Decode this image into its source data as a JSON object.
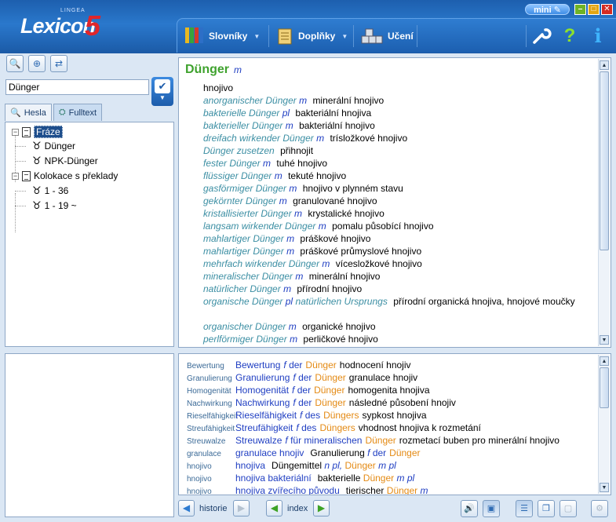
{
  "app": {
    "logo_small": "LINGEA",
    "logo_main": "Lexicon",
    "logo_number": "5",
    "mini_label": "mini"
  },
  "toolbar": {
    "slovniky": "Slovníky",
    "doplnky": "Doplňky",
    "uceni": "Učení",
    "help_symbol": "?",
    "info_symbol": "i"
  },
  "search": {
    "value": "Dünger"
  },
  "tabs": [
    {
      "label": "Hesla"
    },
    {
      "label": "Fulltext"
    }
  ],
  "tree": {
    "node_fraze": "Fráze",
    "item_1": "Dünger",
    "item_2": "NPK-Dünger",
    "node_kolokace": "Kolokace s překlady",
    "item_3": "1 - 36",
    "item_4": "1 - 19 ~"
  },
  "entry": {
    "headword": "Dünger",
    "gender": "m",
    "first_translation": "hnojivo",
    "lines": [
      {
        "de": "anorganischer Dünger",
        "g": "m",
        "cz": "minerální hnojivo"
      },
      {
        "de": "bakterielle Dünger",
        "g": "pl",
        "cz": "bakteriální hnojiva"
      },
      {
        "de": "bakterieller Dünger",
        "g": "m",
        "cz": "bakteriální hnojivo"
      },
      {
        "de": "dreifach wirkender Dünger",
        "g": "m",
        "cz": "trísložkové hnojivo"
      },
      {
        "de": "Dünger zusetzen",
        "g": "",
        "cz": "přihnojit"
      },
      {
        "de": "fester Dünger",
        "g": "m",
        "cz": "tuhé hnojivo"
      },
      {
        "de": "flüssiger Dünger",
        "g": "m",
        "cz": "tekuté hnojivo"
      },
      {
        "de": "gasförmiger Dünger",
        "g": "m",
        "cz": "hnojivo v plynném stavu"
      },
      {
        "de": "gekörnter Dünger",
        "g": "m",
        "cz": "granulované hnojivo"
      },
      {
        "de": "kristallisierter Dünger",
        "g": "m",
        "cz": "krystalické hnojivo"
      },
      {
        "de": "langsam wirkender Dünger",
        "g": "m",
        "cz": "pomalu působící hnojivo"
      },
      {
        "de": "mahlartiger Dünger",
        "g": "m",
        "cz": "práškové hnojivo"
      },
      {
        "de": "mahlartiger Dünger",
        "g": "m",
        "cz": "práškové průmyslové hnojivo"
      },
      {
        "de": "mehrfach wirkender Dünger",
        "g": "m",
        "cz": "vícesložkové hnojivo"
      },
      {
        "de": "mineralischer Dünger",
        "g": "m",
        "cz": "minerální hnojivo"
      },
      {
        "de": "natürlicher Dünger",
        "g": "m",
        "cz": "přírodní hnojivo"
      }
    ],
    "wrap_line": {
      "de1": "organische Dünger",
      "g": "pl",
      "de2": "natürlichen Ursprungs",
      "cz": "přírodní organická hnojiva, hnojové moučky"
    },
    "tail_lines": [
      {
        "de": "organischer Dünger",
        "g": "m",
        "cz": "organické hnojivo"
      },
      {
        "de": "perlförmiger Dünger",
        "g": "m",
        "cz": "perličkové hnojivo"
      }
    ]
  },
  "results": [
    {
      "src": "Bewertung",
      "head": "Bewertung",
      "g": "f",
      "mid": "der",
      "hl": "Dünger",
      "tail": "",
      "tr": "hodnocení hnojiv"
    },
    {
      "src": "Granulierung",
      "head": "Granulierung",
      "g": "f",
      "mid": "der",
      "hl": "Dünger",
      "tail": "",
      "tr": "granulace hnojiv"
    },
    {
      "src": "Homogenität",
      "head": "Homogenität",
      "g": "f",
      "mid": "der",
      "hl": "Dünger",
      "tail": "",
      "tr": "homogenita hnojiva"
    },
    {
      "src": "Nachwirkung",
      "head": "Nachwirkung",
      "g": "f",
      "mid": "der",
      "hl": "Dünger",
      "tail": "",
      "tr": "následné působení hnojiv"
    },
    {
      "src": "Rieselfähigkeit",
      "head": "Rieselfähigkeit",
      "g": "f",
      "mid": "des",
      "hl": "Düngers",
      "tail": "",
      "tr": "sypkost hnojiva"
    },
    {
      "src": "Streufähigkeit",
      "head": "Streufähigkeit",
      "g": "f",
      "mid": "des",
      "hl": "Düngers",
      "tail": "",
      "tr": "vhodnost hnojiva k rozmetání"
    },
    {
      "src": "Streuwalze",
      "head": "Streuwalze",
      "g": "f",
      "mid": "für mineralischen",
      "hl": "Dünger",
      "tail": "",
      "tr": "rozmetací buben pro minerální hnojivo"
    }
  ],
  "results_cz": [
    {
      "src": "granulace",
      "head": "granulace hnojiv",
      "tr": "Granulierung",
      "g": "f",
      "mid": "der",
      "hl": "Dünger",
      "g2": ""
    },
    {
      "src": "hnojivo",
      "head": "hnojiva",
      "tr": "Düngemittel",
      "g": "n pl,",
      "mid": "",
      "hl": "Dünger",
      "g2": "m pl"
    },
    {
      "src": "hnojivo",
      "head": "hnojiva bakteriální",
      "tr": "bakterielle",
      "g": "",
      "mid": "",
      "hl": "Dünger",
      "g2": "m pl"
    },
    {
      "src": "hnojivo",
      "head": "hnojiva zvířecího původu",
      "tr": "tierischer",
      "g": "",
      "mid": "",
      "hl": "Dünger",
      "g2": "m"
    }
  ],
  "bottom": {
    "historie": "historie",
    "index": "index"
  }
}
